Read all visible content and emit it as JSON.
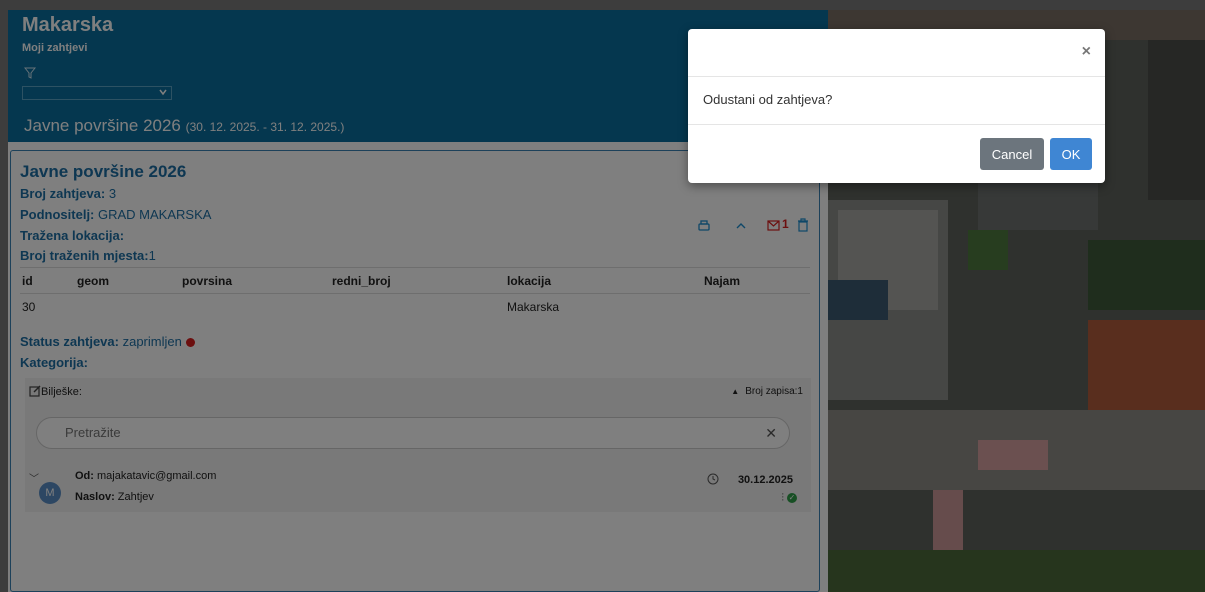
{
  "header": {
    "city": "Makarska",
    "subtitle": "Moji zahtjevi",
    "period_title": "Javne površine 2026",
    "period_range": "(30. 12. 2025. - 31. 12. 2025.)"
  },
  "request": {
    "title": "Javne površine 2026",
    "count_label": "Broj zahtjeva:",
    "count_value": " 3",
    "submitter_label": "Podnositelj:",
    "submitter_value": " GRAD MAKARSKA",
    "location_label": "Tražena lokacija:",
    "spots_label": "Broj traženih mjesta:",
    "spots_value": "1",
    "mail_count": "1",
    "columns": [
      "id",
      "geom",
      "povrsina",
      "redni_broj",
      "lokacija",
      "Najam"
    ],
    "rows": [
      [
        "30",
        "",
        "",
        "",
        "Makarska",
        ""
      ]
    ],
    "status_label": "Status zahtjeva:",
    "status_value": " zaprimljen",
    "category_label": "Kategorija:"
  },
  "notes": {
    "label": "Bilješke:",
    "record_count": "Broj zapisa:1",
    "search_placeholder": "Pretražite",
    "message": {
      "avatar": "M",
      "from_label": "Od:",
      "from_value": " majakatavic@gmail.com",
      "subject_label": "Naslov:",
      "subject_value": " Zahtjev",
      "date": "30.12.2025"
    }
  },
  "modal": {
    "message": "Odustani od zahtjeva?",
    "cancel_label": "Cancel",
    "ok_label": "OK",
    "close_glyph": "×"
  },
  "colors": {
    "header_bg": "#0b6f9e",
    "accent": "#1d6fa5",
    "ok_button": "#3f86d3",
    "cancel_button": "#6c757d",
    "status_dot": "#d91e1e"
  }
}
